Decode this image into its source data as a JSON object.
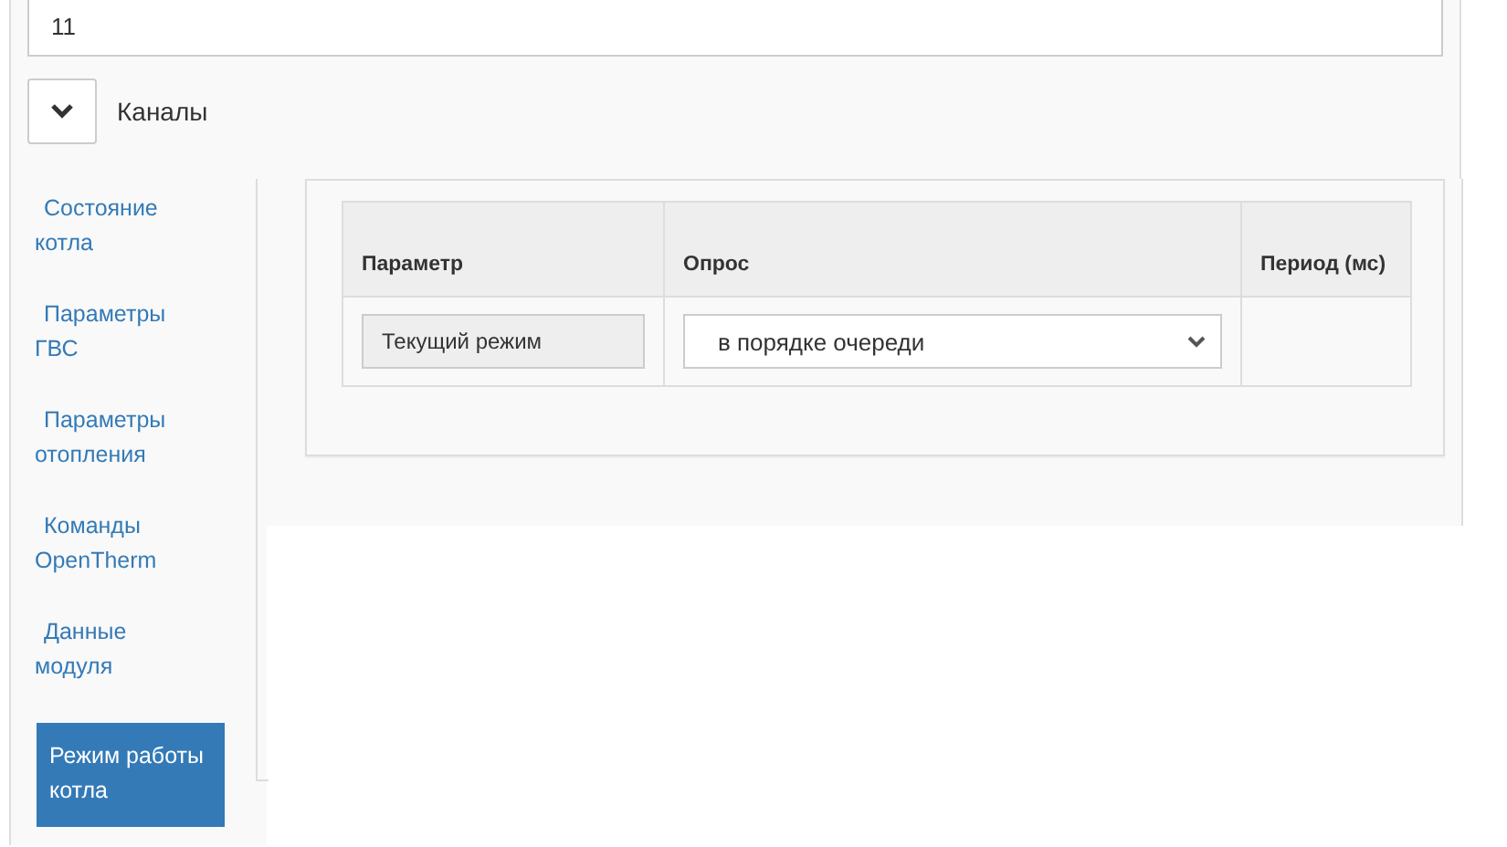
{
  "top_field": {
    "value": "11"
  },
  "section": {
    "expanded": true,
    "title": "Каналы"
  },
  "sidebar": {
    "items": [
      {
        "label": "Состояние котла",
        "selected": false
      },
      {
        "label": "Параметры ГВС",
        "selected": false
      },
      {
        "label": "Параметры отопления",
        "selected": false
      },
      {
        "label": "Команды OpenTherm",
        "selected": false
      },
      {
        "label": "Данные модуля",
        "selected": false
      },
      {
        "label": "Режим работы котла",
        "selected": true
      }
    ]
  },
  "table": {
    "columns": [
      "Параметр",
      "Опрос",
      "Период (мс)"
    ],
    "rows": [
      {
        "parameter": "Текущий режим",
        "poll": "в порядке очереди"
      }
    ]
  }
}
